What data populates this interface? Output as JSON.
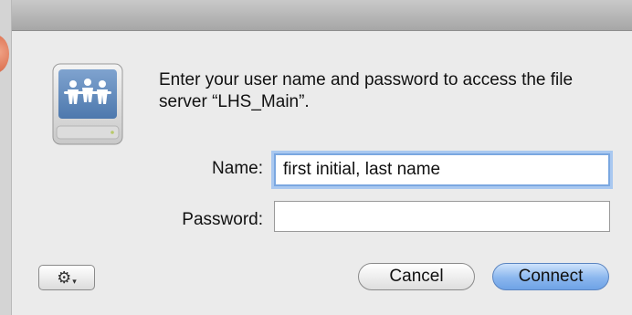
{
  "dialog": {
    "message": "Enter your user name and password to access the file server “LHS_Main”.",
    "name_label": "Name:",
    "name_value": "first initial, last name",
    "password_label": "Password:",
    "password_value": "",
    "gear_icon_glyph": "⚙",
    "gear_caret_glyph": "▾",
    "cancel_label": "Cancel",
    "connect_label": "Connect"
  },
  "icons": {
    "server": "file-server-icon",
    "gear": "gear-icon"
  },
  "colors": {
    "accent_focus": "#7aa7e0",
    "connect_button": "#8ab6ee",
    "close_dot": "#e07a5a"
  }
}
